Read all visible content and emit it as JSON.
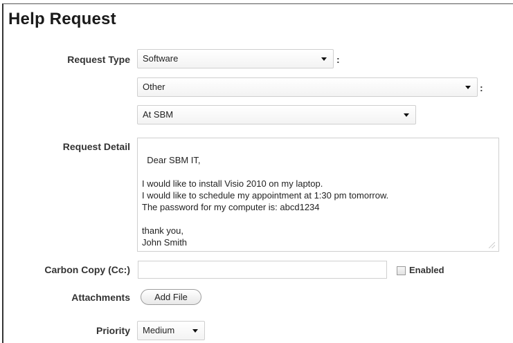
{
  "page": {
    "title": "Help Request"
  },
  "form": {
    "request_type": {
      "label": "Request Type",
      "select1": "Software",
      "select2": "Other",
      "select3": "At SBM",
      "colon": ":"
    },
    "request_detail": {
      "label": "Request Detail",
      "value": "Dear SBM IT,\n\nI would like to install Visio 2010 on my laptop.\nI would like to schedule my appointment at 1:30 pm tomorrow.\nThe password for my computer is: abcd1234\n\nthank you,\nJohn Smith"
    },
    "carbon_copy": {
      "label": "Carbon Copy (Cc:)",
      "value": "",
      "checkbox_label": "Enabled"
    },
    "attachments": {
      "label": "Attachments",
      "button_label": "Add File"
    },
    "priority": {
      "label": "Priority",
      "value": "Medium"
    }
  },
  "icons": {
    "dropdown_caret": "chevron-down-icon",
    "resize_grip": "resize-grip-icon"
  },
  "colors": {
    "text": "#333333",
    "border": "#cfcfcf",
    "title": "#1a1a1a"
  }
}
